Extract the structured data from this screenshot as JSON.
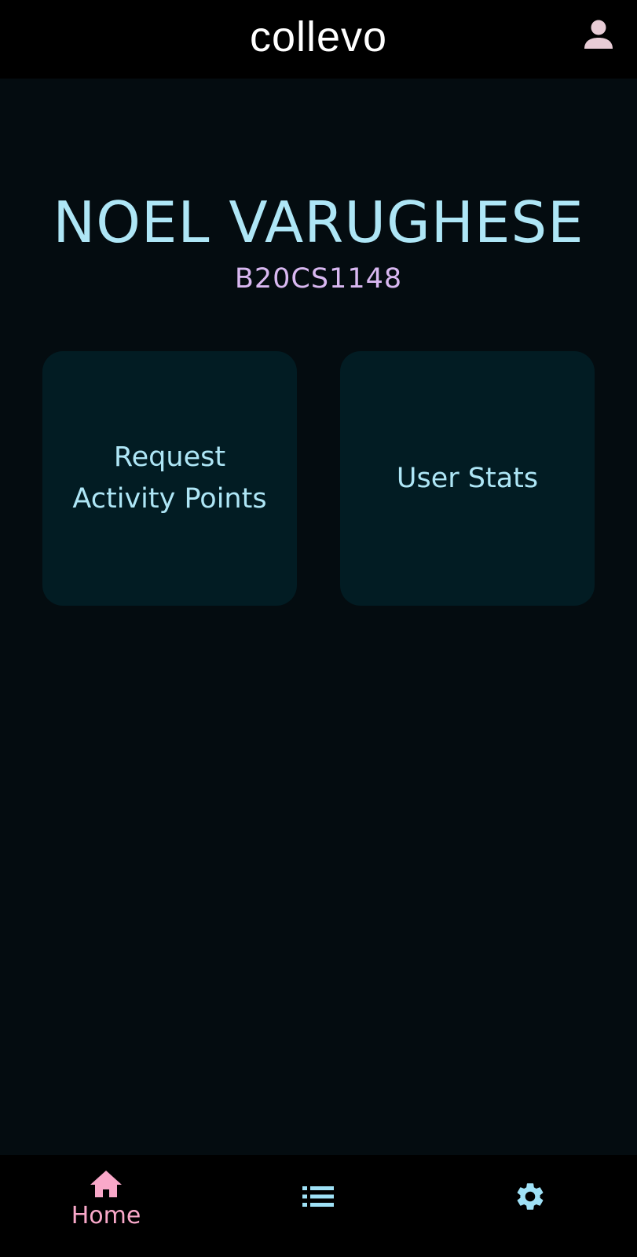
{
  "app": {
    "title": "collevo"
  },
  "profile": {
    "name": "NOEL VARUGHESE",
    "id": "B20CS1148"
  },
  "cards": [
    {
      "label": "Request\nActivity Points"
    },
    {
      "label": "User Stats"
    }
  ],
  "bottom_nav": {
    "items": [
      {
        "icon": "home-icon",
        "label": "Home",
        "selected": true
      },
      {
        "icon": "list-icon",
        "label": ""
      },
      {
        "icon": "gear-icon",
        "label": ""
      }
    ]
  },
  "colors": {
    "background": "#040c10",
    "bar": "#000000",
    "card": "#021c23",
    "accent_cyan": "#aee6f6",
    "accent_purple": "#d9b8f1",
    "accent_pink": "#f9a8c9",
    "profile_icon": "#e8ccd6",
    "nav_icon_inactive": "#9fe1f6"
  }
}
